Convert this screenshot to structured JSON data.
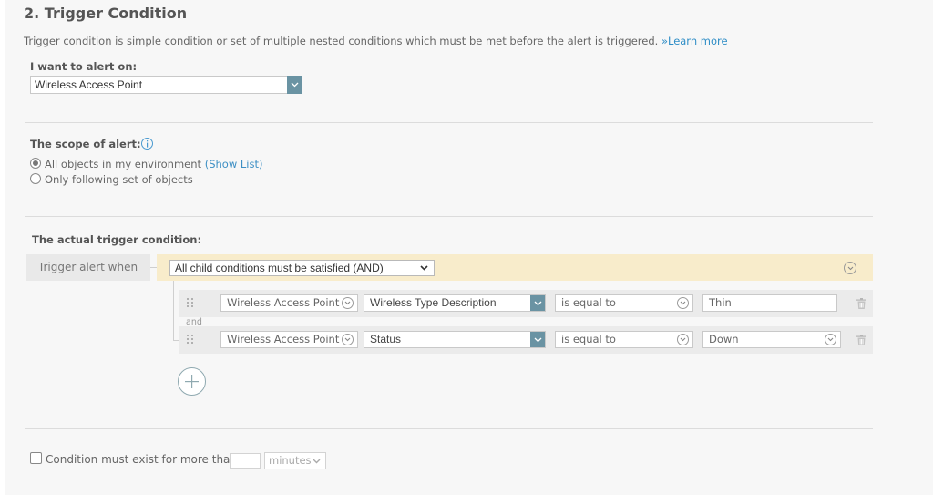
{
  "section": {
    "title": "2. Trigger Condition",
    "description": "Trigger condition is simple condition or set of multiple nested conditions which must be met before the alert is triggered.",
    "learn_more_prefix": "»",
    "learn_more": "Learn more"
  },
  "alert_on": {
    "label": "I want to alert on:",
    "value": "Wireless Access Point",
    "icon": "chevron-down-icon"
  },
  "scope": {
    "label": "The scope of alert:",
    "info_icon": "info-icon",
    "options": [
      {
        "label": "All objects in my environment",
        "link": "(Show List)",
        "selected": true
      },
      {
        "label": "Only following set of objects",
        "selected": false
      }
    ]
  },
  "trigger": {
    "label": "The actual trigger condition:",
    "when_label": "Trigger alert when",
    "mode": "All child conditions must be satisfied (AND)",
    "conditions": [
      {
        "object": "Wireless Access Point",
        "property": "Wireless Type Description",
        "operator": "is equal to",
        "value": "Thin"
      },
      {
        "object": "Wireless Access Point",
        "property": "Status",
        "operator": "is equal to",
        "value": "Down"
      }
    ],
    "joiner": "and"
  },
  "duration": {
    "label": "Condition must exist for more than",
    "value": "",
    "unit": "minutes",
    "checked": false
  },
  "colors": {
    "panel_bg": "#f7f7f7",
    "accent": "#6a93a3",
    "trigger_bar": "#f8eccb",
    "link": "#2e8dc6"
  }
}
